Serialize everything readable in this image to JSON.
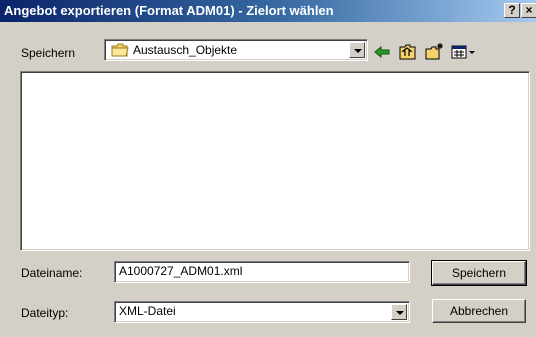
{
  "window": {
    "title": "Angebot exportieren (Format ADM01) - Zielort wählen",
    "help_label": "?",
    "close_label": "×"
  },
  "toolbar": {
    "save_in_label": "Speichern",
    "folder": "Austausch_Objekte",
    "icons": [
      "folder-icon",
      "back-arrow-icon",
      "up-folder-icon",
      "new-folder-icon",
      "view-menu-icon"
    ]
  },
  "filename": {
    "label": "Dateiname:",
    "value": "A1000727_ADM01.xml"
  },
  "filetype": {
    "label": "Dateityp:",
    "value": "XML-Datei"
  },
  "buttons": {
    "save_label": "Speichern",
    "cancel_label": "Abbrechen"
  },
  "colors": {
    "titlebar_start": "#0a246a",
    "titlebar_end": "#a6caf0",
    "face": "#d4d0c8"
  }
}
